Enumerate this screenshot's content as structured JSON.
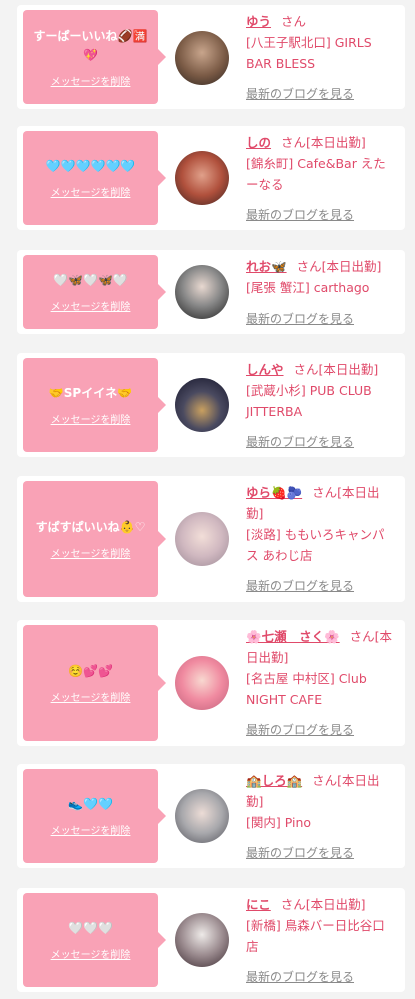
{
  "delete_label": "メッセージを削除",
  "blog_label": "最新のブログを見る",
  "accent": "#e04a6a",
  "bubble_color": "#f9a2b6",
  "cards": [
    {
      "message": "すーぱーいいね🏈🈵💖",
      "name": "ゆう",
      "suffix": "さん",
      "shop": "[八王子駅北口] GIRLS BAR BLESS"
    },
    {
      "message": "🩵🩵🩵🩵🩵🩵",
      "name": "しの",
      "suffix": "さん[本日出勤]",
      "shop": "[錦糸町] Cafe&Bar えたーなる"
    },
    {
      "message": "🤍🦋🤍🦋🤍",
      "name": "れお🦋",
      "suffix": "さん[本日出勤]",
      "shop": "[尾張 蟹江] carthago"
    },
    {
      "message": "🤝SPイイネ🤝",
      "name": "しんや",
      "suffix": "さん[本日出勤]",
      "shop": "[武蔵小杉] PUB CLUB JITTERBA"
    },
    {
      "message": "すぱすぱいいね👶♡",
      "name": "ゆら🍓🫐",
      "suffix": "さん[本日出勤]",
      "shop": "[淡路] ももいろキャンパス あわじ店"
    },
    {
      "message": "☺️💕💕",
      "name": "🌸七瀬　さく🌸",
      "suffix": "さん[本日出勤]",
      "shop": "[名古屋 中村区] Club NIGHT CAFE"
    },
    {
      "message": "👟🩵🩵",
      "name": "🏫しろ🏫",
      "suffix": "さん[本日出勤]",
      "shop": "[関内] Pino"
    },
    {
      "message": "🤍🤍🤍",
      "name": "にこ",
      "suffix": "さん[本日出勤]",
      "shop": "[新橋] 鳥森バー日比谷口店"
    }
  ]
}
